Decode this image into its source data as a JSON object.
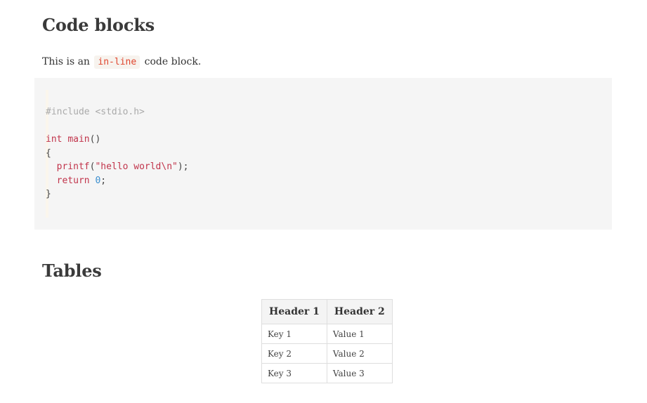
{
  "sections": {
    "code_blocks_heading": "Code blocks",
    "tables_heading": "Tables"
  },
  "paragraph": {
    "before": "This is an ",
    "inline_code": "in-line",
    "after": " code block."
  },
  "code_block": {
    "include_line": "#include <stdio.h>",
    "type_int": "int",
    "func_main": "main",
    "main_parens": "()",
    "open_brace": "{",
    "func_printf": "printf",
    "paren_open": "(",
    "string_hello": "\"hello world\\n\"",
    "paren_close_semi": ");",
    "keyword_return": "return",
    "number_zero": "0",
    "semicolon": ";",
    "close_brace": "}"
  },
  "table": {
    "headers": [
      "Header 1",
      "Header 2"
    ],
    "rows": [
      [
        "Key 1",
        "Value 1"
      ],
      [
        "Key 2",
        "Value 2"
      ],
      [
        "Key 3",
        "Value 3"
      ]
    ]
  },
  "colors": {
    "inline_code_text": "#e0462e",
    "inline_code_bg": "#f7f3ee",
    "code_block_bg": "#f5f5f5",
    "syntax_keyword": "#c1344b",
    "syntax_number": "#3c8fcf",
    "syntax_comment": "#aaaaaa"
  }
}
